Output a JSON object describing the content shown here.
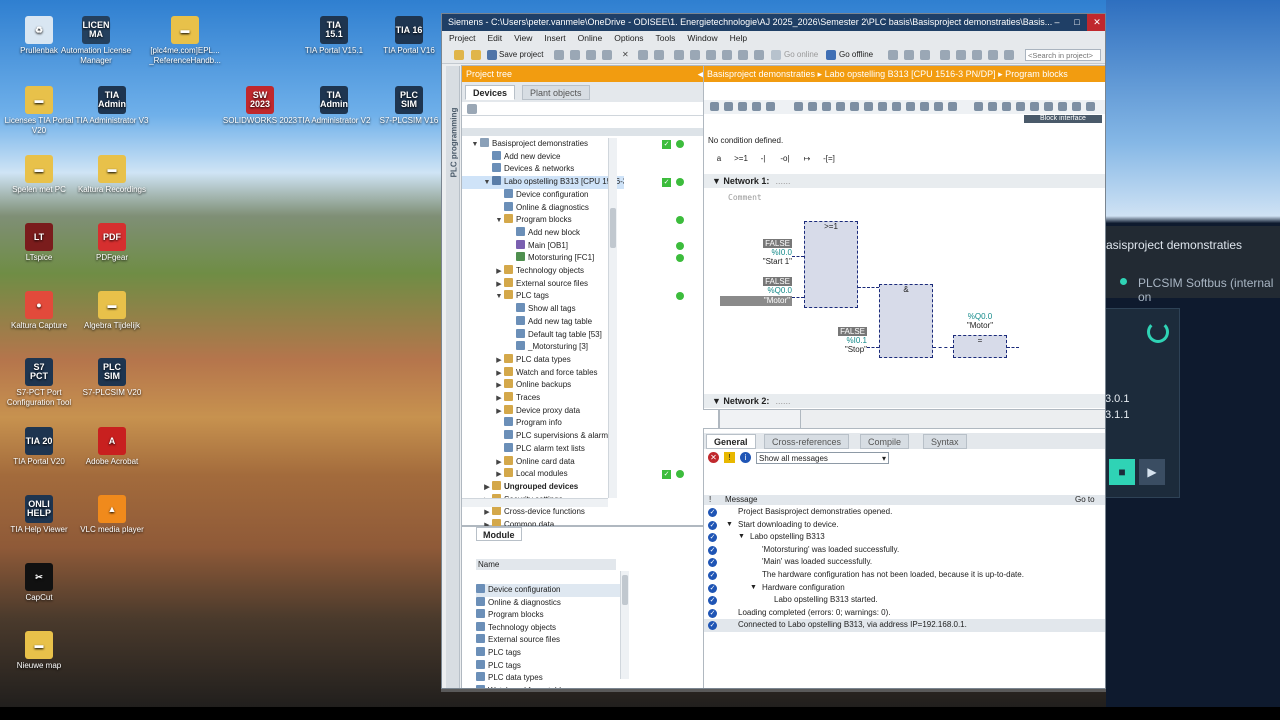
{
  "desktop": {
    "icons": [
      {
        "label": "Prullenbak",
        "glyph": "♻",
        "color": "#d9e6f2"
      },
      {
        "label": "Automation License Manager",
        "glyph": "LICEN MA",
        "color": "#24405e"
      },
      {
        "label": "[plc4me.com]EPL... _ReferenceHandb...",
        "glyph": "▬",
        "color": "#e8c14a"
      },
      {
        "label": "TIA Portal V15.1",
        "glyph": "TIA 15.1",
        "color": "#1e3550"
      },
      {
        "label": "TIA Portal V16",
        "glyph": "TIA 16",
        "color": "#1e3550"
      },
      {
        "label": "Licenses TIA Portal V20",
        "glyph": "▬",
        "color": "#e8c14a"
      },
      {
        "label": "TIA Administrator V3",
        "glyph": "TIA Admin",
        "color": "#1e3550"
      },
      {
        "label": "SOLIDWORKS 2023",
        "glyph": "SW 2023",
        "color": "#c0282d"
      },
      {
        "label": "TIA Administrator V2",
        "glyph": "TIA Admin",
        "color": "#1e3550"
      },
      {
        "label": "S7-PLCSIM V16",
        "glyph": "PLC SIM",
        "color": "#1e3550"
      },
      {
        "label": "Spelen met PC",
        "glyph": "▬",
        "color": "#e8c14a"
      },
      {
        "label": "Kaltura Recordings",
        "glyph": "▬",
        "color": "#e8c14a"
      },
      {
        "label": "LTspice",
        "glyph": "LT",
        "color": "#7a1c1c"
      },
      {
        "label": "PDFgear",
        "glyph": "PDF",
        "color": "#d62f2f"
      },
      {
        "label": "Kaltura Capture",
        "glyph": "●",
        "color": "#e24a3b"
      },
      {
        "label": "Algebra Tijdelijk",
        "glyph": "▬",
        "color": "#e8c14a"
      },
      {
        "label": "S7-PCT Port Configuration Tool",
        "glyph": "S7 PCT",
        "color": "#1e3550"
      },
      {
        "label": "S7-PLCSIM V20",
        "glyph": "PLC SIM",
        "color": "#1e3550"
      },
      {
        "label": "TIA Portal V20",
        "glyph": "TIA 20",
        "color": "#1e3550"
      },
      {
        "label": "Adobe Acrobat",
        "glyph": "A",
        "color": "#c8201f"
      },
      {
        "label": "TIA Help Viewer",
        "glyph": "ONLI HELP",
        "color": "#1e3550"
      },
      {
        "label": "VLC media player",
        "glyph": "▲",
        "color": "#f08a1c"
      },
      {
        "label": "CapCut",
        "glyph": "✂",
        "color": "#111111"
      },
      {
        "label": "Nieuwe map",
        "glyph": "▬",
        "color": "#e8c14a"
      }
    ]
  },
  "plcsim": {
    "title": "asisproject demonstraties",
    "status": "PLCSIM Softbus (internal on",
    "ip1": "3.0.1",
    "ip2": "3.1.1",
    "accent": "#2fd3b5"
  },
  "window": {
    "title": "Siemens  -  C:\\Users\\peter.vanmele\\OneDrive - ODISEE\\1. Energietechnologie\\AJ 2025_2026\\Semester 2\\PLC basis\\Basisproject demonstraties\\Basis...",
    "menu": [
      "Project",
      "Edit",
      "View",
      "Insert",
      "Online",
      "Options",
      "Tools",
      "Window",
      "Help"
    ],
    "toolbar": {
      "save": "Save project",
      "go_online": "Go online",
      "go_offline": "Go offline",
      "search_placeholder": "<Search in project>"
    }
  },
  "vertical_tab": "PLC programming",
  "project_tree": {
    "title": "Project tree",
    "tabs": [
      "Devices",
      "Plant objects"
    ],
    "items": [
      {
        "label": "Basisproject demonstraties",
        "indent": 0,
        "toggle": "▼",
        "icon": "#8aa0b8",
        "bold": false,
        "sel": false
      },
      {
        "label": "Add new device",
        "indent": 1,
        "toggle": "",
        "icon": "#6b8fb8",
        "bold": false,
        "sel": false
      },
      {
        "label": "Devices & networks",
        "indent": 1,
        "toggle": "",
        "icon": "#6b8fb8",
        "bold": false,
        "sel": false
      },
      {
        "label": "Labo opstelling B313 [CPU 1516-3 PN/DP]",
        "indent": 1,
        "toggle": "▼",
        "icon": "#5a7da8",
        "bold": false,
        "sel": true
      },
      {
        "label": "Device configuration",
        "indent": 2,
        "toggle": "",
        "icon": "#6b8fb8",
        "bold": false,
        "sel": false
      },
      {
        "label": "Online & diagnostics",
        "indent": 2,
        "toggle": "",
        "icon": "#6b8fb8",
        "bold": false,
        "sel": false
      },
      {
        "label": "Program blocks",
        "indent": 2,
        "toggle": "▼",
        "icon": "#d4a84a",
        "bold": false,
        "sel": false
      },
      {
        "label": "Add new block",
        "indent": 3,
        "toggle": "",
        "icon": "#6b8fb8",
        "bold": false,
        "sel": false
      },
      {
        "label": "Main [OB1]",
        "indent": 3,
        "toggle": "",
        "icon": "#7a5fb0",
        "bold": false,
        "sel": false
      },
      {
        "label": "Motorsturing [FC1]",
        "indent": 3,
        "toggle": "",
        "icon": "#4f8f4f",
        "bold": false,
        "sel": false
      },
      {
        "label": "Technology objects",
        "indent": 2,
        "toggle": "▶",
        "icon": "#d4a84a",
        "bold": false,
        "sel": false
      },
      {
        "label": "External source files",
        "indent": 2,
        "toggle": "▶",
        "icon": "#d4a84a",
        "bold": false,
        "sel": false
      },
      {
        "label": "PLC tags",
        "indent": 2,
        "toggle": "▼",
        "icon": "#d4a84a",
        "bold": false,
        "sel": false
      },
      {
        "label": "Show all tags",
        "indent": 3,
        "toggle": "",
        "icon": "#6b8fb8",
        "bold": false,
        "sel": false
      },
      {
        "label": "Add new tag table",
        "indent": 3,
        "toggle": "",
        "icon": "#6b8fb8",
        "bold": false,
        "sel": false
      },
      {
        "label": "Default tag table [53]",
        "indent": 3,
        "toggle": "",
        "icon": "#6b8fb8",
        "bold": false,
        "sel": false
      },
      {
        "label": "_Motorsturing [3]",
        "indent": 3,
        "toggle": "",
        "icon": "#6b8fb8",
        "bold": false,
        "sel": false
      },
      {
        "label": "PLC data types",
        "indent": 2,
        "toggle": "▶",
        "icon": "#d4a84a",
        "bold": false,
        "sel": false
      },
      {
        "label": "Watch and force tables",
        "indent": 2,
        "toggle": "▶",
        "icon": "#d4a84a",
        "bold": false,
        "sel": false
      },
      {
        "label": "Online backups",
        "indent": 2,
        "toggle": "▶",
        "icon": "#d4a84a",
        "bold": false,
        "sel": false
      },
      {
        "label": "Traces",
        "indent": 2,
        "toggle": "▶",
        "icon": "#d4a84a",
        "bold": false,
        "sel": false
      },
      {
        "label": "Device proxy data",
        "indent": 2,
        "toggle": "▶",
        "icon": "#d4a84a",
        "bold": false,
        "sel": false
      },
      {
        "label": "Program info",
        "indent": 2,
        "toggle": "",
        "icon": "#6b8fb8",
        "bold": false,
        "sel": false
      },
      {
        "label": "PLC supervisions & alarms",
        "indent": 2,
        "toggle": "",
        "icon": "#6b8fb8",
        "bold": false,
        "sel": false
      },
      {
        "label": "PLC alarm text lists",
        "indent": 2,
        "toggle": "",
        "icon": "#6b8fb8",
        "bold": false,
        "sel": false
      },
      {
        "label": "Online card data",
        "indent": 2,
        "toggle": "▶",
        "icon": "#d4a84a",
        "bold": false,
        "sel": false
      },
      {
        "label": "Local modules",
        "indent": 2,
        "toggle": "▶",
        "icon": "#d4a84a",
        "bold": false,
        "sel": false
      },
      {
        "label": "Ungrouped devices",
        "indent": 1,
        "toggle": "▶",
        "icon": "#d4a84a",
        "bold": true,
        "sel": false
      },
      {
        "label": "Security settings",
        "indent": 1,
        "toggle": "▶",
        "icon": "#d4a84a",
        "bold": false,
        "sel": false
      },
      {
        "label": "Cross-device functions",
        "indent": 1,
        "toggle": "▶",
        "icon": "#d4a84a",
        "bold": false,
        "sel": false
      },
      {
        "label": "Common data",
        "indent": 1,
        "toggle": "▶",
        "icon": "#d4a84a",
        "bold": false,
        "sel": false
      }
    ]
  },
  "details": {
    "tab": "Module",
    "col": "Name",
    "items": [
      "Device configuration",
      "Online & diagnostics",
      "Program blocks",
      "Technology objects",
      "External source files",
      "PLC tags",
      "PLC tags",
      "PLC data types",
      "Watch and force tables"
    ]
  },
  "editor": {
    "breadcrumb": "Basisproject demonstraties  ▸  Labo opstelling B313 [CPU 1516-3 PN/DP]  ▸  Program blocks",
    "block_interface": "Block interface",
    "condition": "No condition defined.",
    "ladder_tools": [
      "a",
      ">=1",
      "-|",
      "-o|",
      "↦",
      "-[=]"
    ],
    "network1": "Network 1:",
    "network2": "Network 2:",
    "network_dots": "......",
    "comment": "Comment",
    "or_block": ">=1",
    "and_block": "&",
    "assign_block": "=",
    "start_value": "FALSE",
    "start_addr": "%I0.0",
    "start_name": "\"Start 1\"",
    "motor_value": "FALSE",
    "motor_addr": "%Q0.0",
    "motor_name": "\"Motor\"",
    "stop_value": "FALSE",
    "stop_addr": "%I0.1",
    "stop_name": "\"Stop\"",
    "out_addr": "%Q0.0",
    "out_name": "\"Motor\""
  },
  "inspector": {
    "tabs": [
      "General",
      "Cross-references",
      "Compile",
      "Syntax"
    ],
    "filter": "Show all messages",
    "col_num": "!",
    "col_message": "Message",
    "col_goto": "Go to",
    "messages": [
      {
        "text": "Project Basisproject demonstraties opened.",
        "indent": 0,
        "toggle": ""
      },
      {
        "text": "Start downloading to device.",
        "indent": 0,
        "toggle": "▼"
      },
      {
        "text": "Labo opstelling B313",
        "indent": 1,
        "toggle": "▼"
      },
      {
        "text": "'Motorsturing' was loaded successfully.",
        "indent": 2,
        "toggle": ""
      },
      {
        "text": "'Main' was loaded successfully.",
        "indent": 2,
        "toggle": ""
      },
      {
        "text": "The hardware configuration has not been loaded, because it is up-to-date.",
        "indent": 2,
        "toggle": ""
      },
      {
        "text": "Hardware configuration",
        "indent": 2,
        "toggle": "▼"
      },
      {
        "text": "Labo opstelling B313 started.",
        "indent": 3,
        "toggle": ""
      },
      {
        "text": "Loading completed (errors: 0; warnings: 0).",
        "indent": 0,
        "toggle": ""
      },
      {
        "text": "Connected to Labo opstelling B313, via address IP=192.168.0.1.",
        "indent": 0,
        "toggle": ""
      }
    ]
  }
}
